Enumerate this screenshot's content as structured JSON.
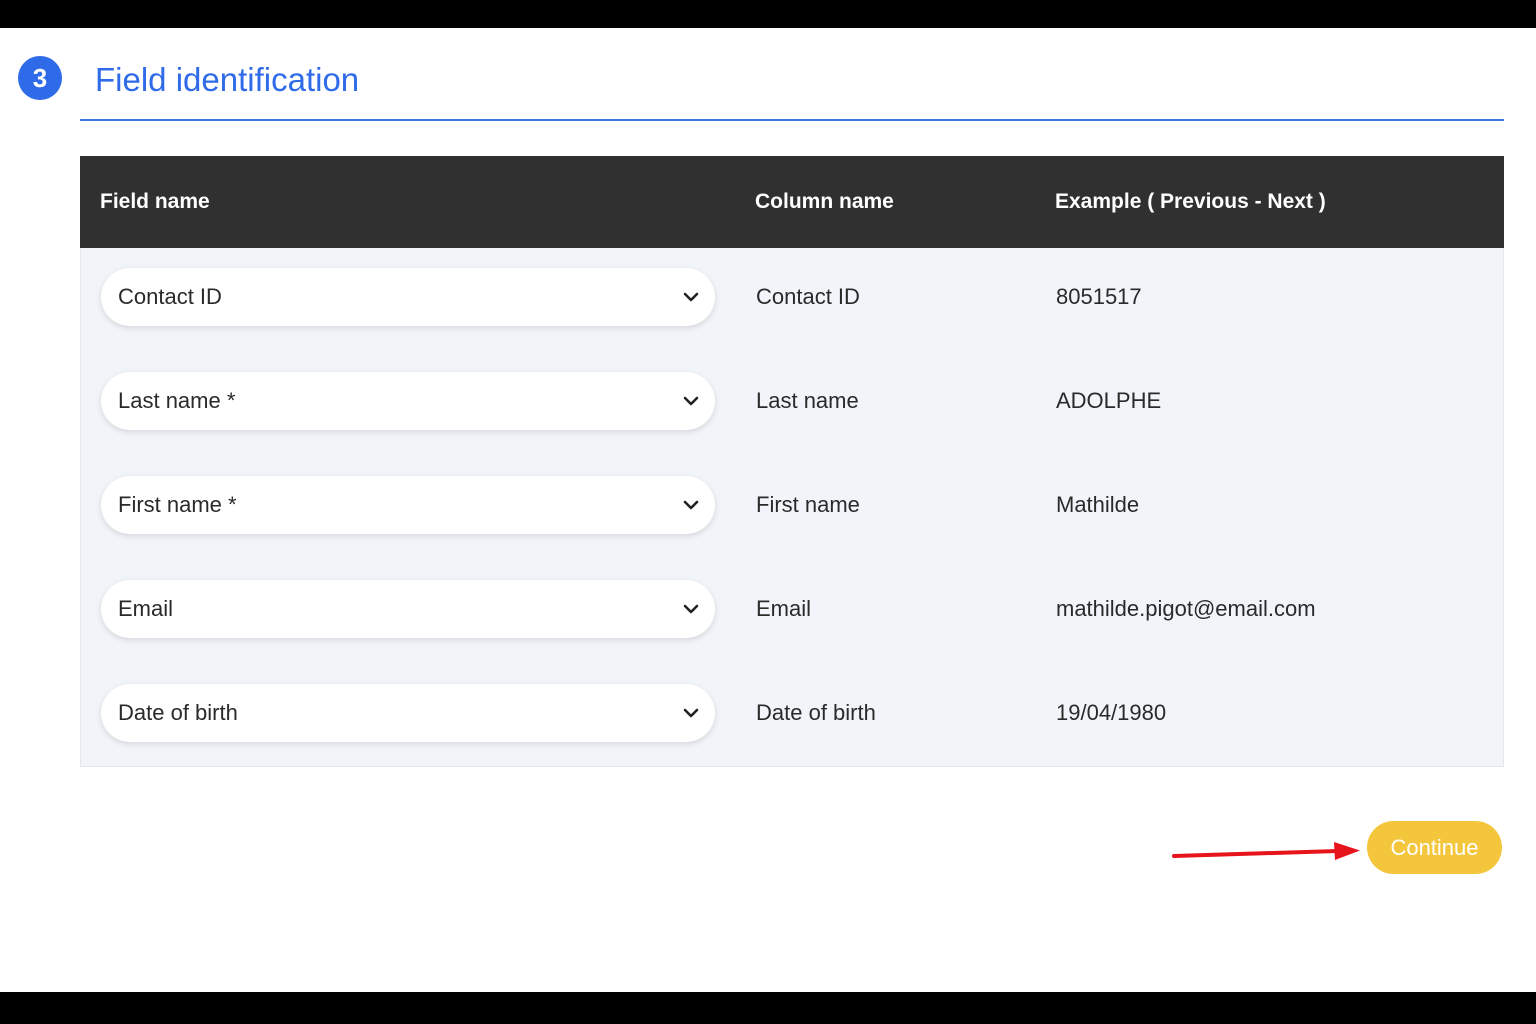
{
  "section": {
    "step_number": "3",
    "title": "Field identification"
  },
  "table": {
    "headers": {
      "field_name": "Field name",
      "column_name": "Column name",
      "example": "Example ( Previous - Next )"
    },
    "rows": [
      {
        "field": "Contact ID",
        "column": "Contact ID",
        "example": "8051517"
      },
      {
        "field": "Last name *",
        "column": "Last name",
        "example": "ADOLPHE"
      },
      {
        "field": "First name *",
        "column": "First name",
        "example": "Mathilde"
      },
      {
        "field": "Email",
        "column": "Email",
        "example": "mathilde.pigot@email.com"
      },
      {
        "field": "Date of birth",
        "column": "Date of birth",
        "example": "19/04/1980"
      }
    ]
  },
  "actions": {
    "continue_label": "Continue"
  },
  "icons": {
    "select_indicator": "chevron-down-icon",
    "annotation": "red-arrow-icon"
  },
  "colors": {
    "accent": "#2f6be8",
    "header_bg": "#303030",
    "body_bg": "#f1f4f9",
    "button": "#f4c63c",
    "annotation_arrow": "#e8141c"
  }
}
